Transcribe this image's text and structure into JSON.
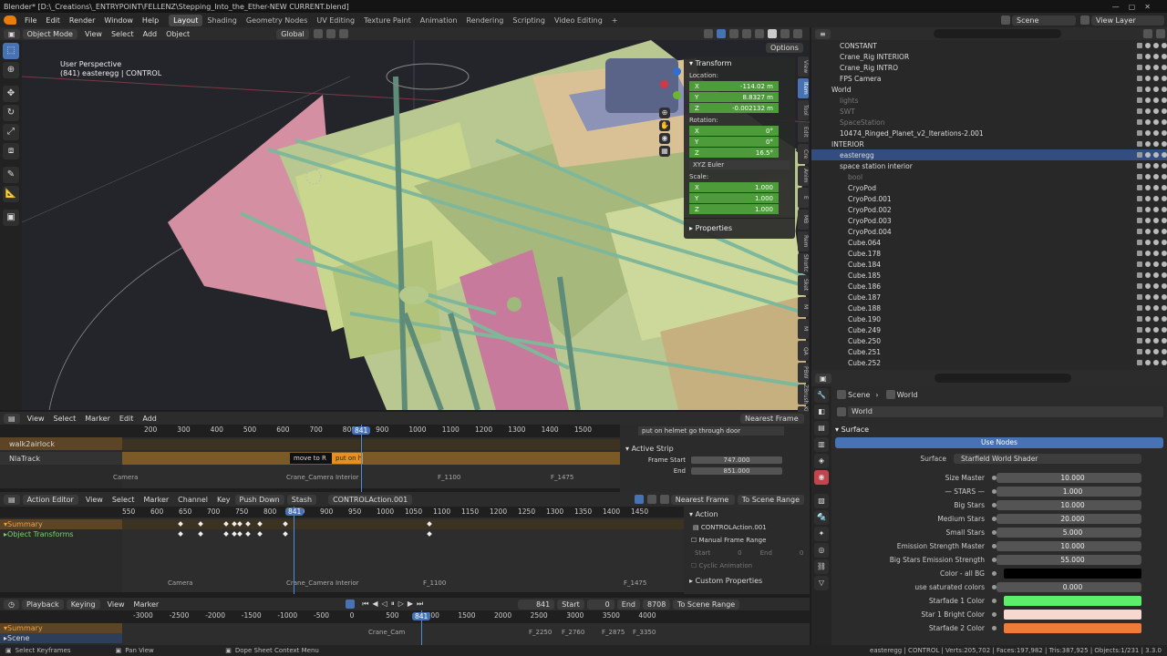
{
  "title": "Blender* [D:\\_Creations\\_ENTRYPOINT\\FELLENZ\\Stepping_Into_the_Ether-NEW CURRENT.blend]",
  "menus": [
    "File",
    "Edit",
    "Render",
    "Window",
    "Help"
  ],
  "workspaces": [
    "Layout",
    "Shading",
    "Geometry Nodes",
    "UV Editing",
    "Texture Paint",
    "Animation",
    "Rendering",
    "Scripting",
    "Video Editing"
  ],
  "top_right": {
    "scene": "Scene",
    "view_layer": "View Layer"
  },
  "viewport_header": {
    "mode": "Object Mode",
    "menus": [
      "View",
      "Select",
      "Add",
      "Object"
    ],
    "orientation": "Global",
    "options": "Options"
  },
  "viewport": {
    "label1": "User Perspective",
    "label2": "(841) easteregg | CONTROL"
  },
  "npanel": {
    "transform": "Transform",
    "location": "Location:",
    "lx": "-114.02 m",
    "ly": "8.8327 m",
    "lz": "-0.002132 m",
    "rotation": "Rotation:",
    "rx": "0°",
    "ry": "0°",
    "rz": "16.5°",
    "euler": "XYZ Euler",
    "scale": "Scale:",
    "sx": "1.000",
    "sy": "1.000",
    "sz": "1.000",
    "properties": "Properties"
  },
  "vtabs": [
    "View",
    "Item",
    "Tool",
    "Edit",
    "Cre",
    "Anim",
    "E",
    "MB",
    "Rem",
    "Shortc",
    "Sket",
    "M",
    "M",
    "QA",
    "PBW",
    "ZBrush",
    "Kitbash",
    "Mix"
  ],
  "outliner": [
    {
      "name": "CONSTANT",
      "indent": 3
    },
    {
      "name": "Crane_Rig INTERIOR",
      "indent": 3
    },
    {
      "name": "Crane_Rig INTRO",
      "indent": 3
    },
    {
      "name": "FPS Camera",
      "indent": 3
    },
    {
      "name": "World",
      "indent": 2
    },
    {
      "name": "lights",
      "indent": 3,
      "dim": true
    },
    {
      "name": "SWT",
      "indent": 3,
      "dim": true
    },
    {
      "name": "SpaceStation",
      "indent": 3,
      "dim": true
    },
    {
      "name": "10474_Ringed_Planet_v2_Iterations-2.001",
      "indent": 3
    },
    {
      "name": "INTERIOR",
      "indent": 2
    },
    {
      "name": "easteregg",
      "indent": 3
    },
    {
      "name": "space station interior",
      "indent": 3
    },
    {
      "name": "bool",
      "indent": 4,
      "dim": true
    },
    {
      "name": "CryoPod",
      "indent": 4
    },
    {
      "name": "CryoPod.001",
      "indent": 4
    },
    {
      "name": "CryoPod.002",
      "indent": 4
    },
    {
      "name": "CryoPod.003",
      "indent": 4
    },
    {
      "name": "CryoPod.004",
      "indent": 4
    },
    {
      "name": "Cube.064",
      "indent": 4
    },
    {
      "name": "Cube.178",
      "indent": 4
    },
    {
      "name": "Cube.184",
      "indent": 4
    },
    {
      "name": "Cube.185",
      "indent": 4
    },
    {
      "name": "Cube.186",
      "indent": 4
    },
    {
      "name": "Cube.187",
      "indent": 4
    },
    {
      "name": "Cube.188",
      "indent": 4
    },
    {
      "name": "Cube.190",
      "indent": 4
    },
    {
      "name": "Cube.249",
      "indent": 4
    },
    {
      "name": "Cube.250",
      "indent": 4
    },
    {
      "name": "Cube.251",
      "indent": 4
    },
    {
      "name": "Cube.252",
      "indent": 4
    }
  ],
  "props": {
    "breadcrumb_scene": "Scene",
    "breadcrumb_world": "World",
    "world_name": "World",
    "surface_header": "Surface",
    "use_nodes": "Use Nodes",
    "surface_label": "Surface",
    "surface_value": "Starfield World Shader",
    "rows": [
      {
        "label": "Size Master",
        "value": "10.000"
      },
      {
        "label": "— STARS —",
        "value": "1.000"
      },
      {
        "label": "Big Stars",
        "value": "10.000"
      },
      {
        "label": "Medium Stars",
        "value": "20.000"
      },
      {
        "label": "Small Stars",
        "value": "5.000"
      },
      {
        "label": "Emission Strength Master",
        "value": "10.000"
      },
      {
        "label": "Big Stars Emission Strength",
        "value": "55.000"
      },
      {
        "label": "Color - all BG",
        "value": "",
        "color": "#000000"
      },
      {
        "label": "use saturated colors",
        "value": "0.000"
      },
      {
        "label": "Starfade 1 Color",
        "value": "",
        "color": "#5cf06a"
      },
      {
        "label": "Star 1 Bright Color",
        "value": "",
        "color": "#f6d8d0"
      },
      {
        "label": "Starfade 2 Color",
        "value": "",
        "color": "#f07a3a"
      }
    ]
  },
  "nla": {
    "menus": [
      "View",
      "Select",
      "Marker",
      "Edit",
      "Add"
    ],
    "snap": "Nearest Frame",
    "ticks": [
      "200",
      "300",
      "400",
      "500",
      "600",
      "700",
      "800",
      "900",
      "1000",
      "1100",
      "1200",
      "1300",
      "1400",
      "1500"
    ],
    "frame": "841",
    "track1": "walk2airlock",
    "track2": "NlaTrack",
    "strip1": "move to R",
    "strip2": "put on h",
    "active_strip_header": "put on helmet  go through door",
    "active_strip": "Active Strip",
    "frame_start_label": "Frame Start",
    "frame_start": "747.000",
    "end_label": "End",
    "end": "851.000",
    "markers": [
      "Camera",
      "Crane_Camera Interior",
      "F_1100",
      "F_1475"
    ],
    "tabs": [
      "Strip",
      "Edited",
      "Mo"
    ]
  },
  "dope": {
    "editor": "Action Editor",
    "menus": [
      "View",
      "Select",
      "Marker",
      "Channel",
      "Key"
    ],
    "push_down": "Push Down",
    "stash": "Stash",
    "action": "CONTROLAction.001",
    "snap": "Nearest Frame",
    "to_scene_range": "To Scene Range",
    "ticks": [
      "550",
      "600",
      "650",
      "700",
      "750",
      "800",
      "850",
      "900",
      "950",
      "1000",
      "1050",
      "1100",
      "1150",
      "1200",
      "1250",
      "1300",
      "1350",
      "1400",
      "1450"
    ],
    "frame": "841",
    "channels": [
      "Summary",
      "Object Transforms"
    ],
    "side_action": "Action",
    "side_action_name": "CONTROLAction.001",
    "manual": "Manual Frame Range",
    "start_label": "Start",
    "start": "0",
    "end_label": "End",
    "end": "0",
    "cyclic": "Cyclic Animation",
    "custom": "Custom Properties",
    "markers": [
      "Camera",
      "Crane_Camera Interior",
      "F_1100",
      "F_1475"
    ]
  },
  "timeline": {
    "playback": "Playback",
    "keying": "Keying",
    "menus": [
      "View",
      "Marker"
    ],
    "frame": "841",
    "start_label": "Start",
    "start": "0",
    "end_label": "End",
    "end": "8708",
    "to_scene_range": "To Scene Range",
    "ticks": [
      "-3000",
      "-2500",
      "-2000",
      "-1500",
      "-1000",
      "-500",
      "0",
      "500",
      "1000",
      "1500",
      "2000",
      "2500",
      "3000",
      "3500",
      "4000"
    ],
    "channels": [
      "Summary",
      "Scene"
    ],
    "markers": [
      "Crane_Cam",
      "F_2250",
      "F_2760",
      "F_2875",
      "F_3350"
    ]
  },
  "status": {
    "left": "Select Keyframes",
    "mid": "Pan View",
    "ctx": "Dope Sheet Context Menu",
    "right": "easteregg | CONTROL | Verts:205,702 | Faces:197,982 | Tris:387,925 | Objects:1/231 | 3.3.0"
  },
  "colors": {
    "accent": "#4772b3",
    "green_field": "#4d9b3a",
    "nla_orange": "#c47a1c"
  }
}
